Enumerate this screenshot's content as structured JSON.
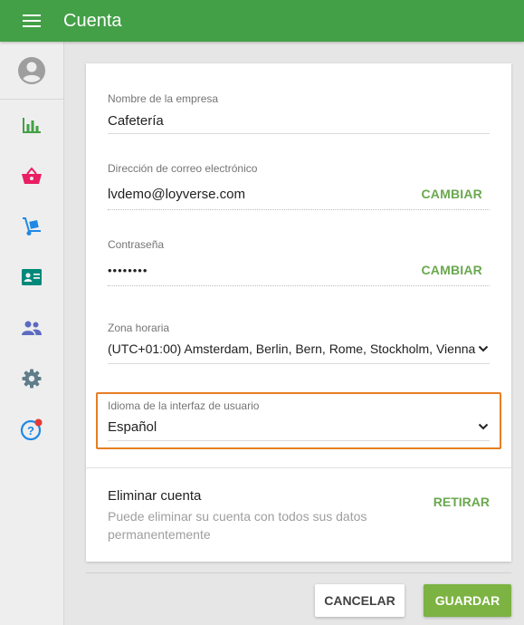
{
  "header": {
    "title": "Cuenta",
    "menu_icon": "hamburger-menu-icon",
    "color": "#43a047"
  },
  "sidebar": {
    "items": [
      {
        "name": "account",
        "icon": "account-circle-icon",
        "color": "#9e9e9e"
      },
      {
        "name": "reports",
        "icon": "bar-chart-icon",
        "color": "#43a047"
      },
      {
        "name": "items",
        "icon": "basket-icon",
        "color": "#e91e63"
      },
      {
        "name": "inventory",
        "icon": "hand-truck-icon",
        "color": "#1e88e5"
      },
      {
        "name": "customers",
        "icon": "id-card-icon",
        "color": "#00897b"
      },
      {
        "name": "employees",
        "icon": "people-icon",
        "color": "#5c6bc0"
      },
      {
        "name": "settings",
        "icon": "gear-icon",
        "color": "#607d8b"
      },
      {
        "name": "help",
        "icon": "help-icon",
        "color": "#1e88e5",
        "badge_color": "#e53935"
      }
    ]
  },
  "form": {
    "company": {
      "label": "Nombre de la empresa",
      "value": "Cafetería"
    },
    "email": {
      "label": "Dirección de correo electrónico",
      "value": "lvdemo@loyverse.com",
      "action": "CAMBIAR"
    },
    "password": {
      "label": "Contraseña",
      "value": "••••••••",
      "action": "CAMBIAR"
    },
    "timezone": {
      "label": "Zona horaria",
      "value": "(UTC+01:00) Amsterdam, Berlin, Bern, Rome, Stockholm, Vienna"
    },
    "language": {
      "label": "Idioma de la interfaz de usuario",
      "value": "Español"
    }
  },
  "delete_account": {
    "title": "Eliminar cuenta",
    "description": "Puede eliminar su cuenta con todos sus datos permanentemente",
    "action": "RETIRAR"
  },
  "footer": {
    "cancel_label": "CANCELAR",
    "save_label": "GUARDAR"
  },
  "colors": {
    "accent": "#43a047",
    "action_text": "#6aa84f",
    "save_button": "#7cb342",
    "highlight": "#e67e22"
  }
}
